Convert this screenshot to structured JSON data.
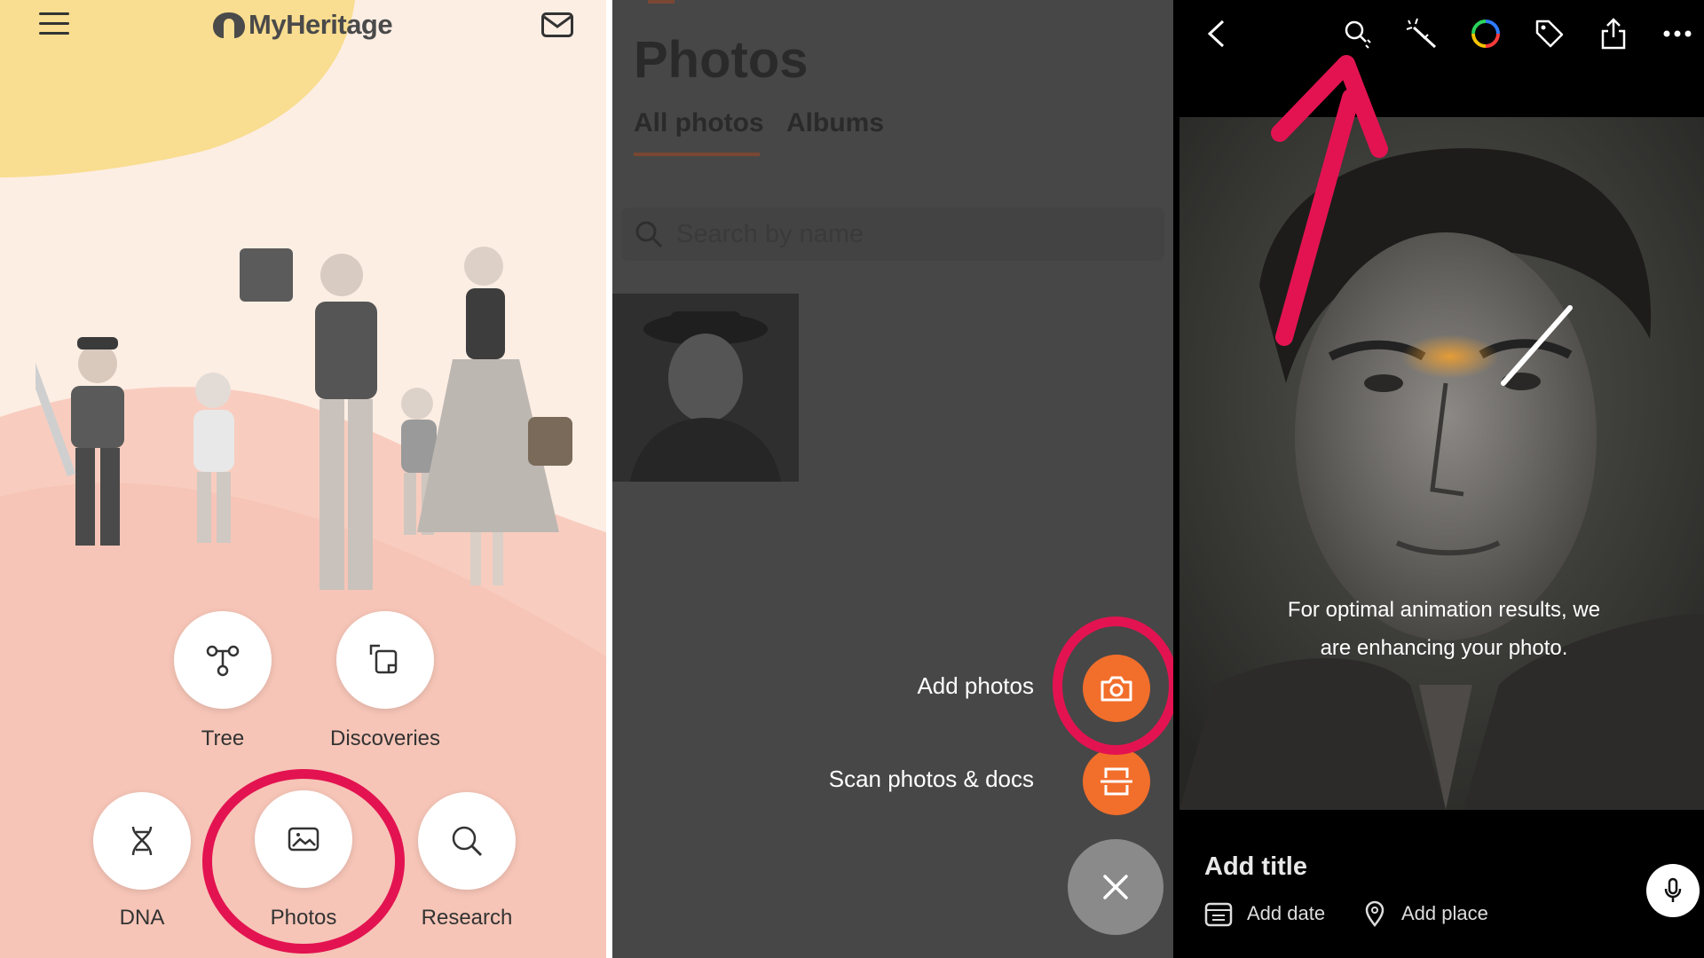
{
  "colors": {
    "accent_orange": "#f26e2b",
    "annotation_red": "#e31351",
    "dark_bg": "#474747"
  },
  "home": {
    "logo_text": "MyHeritage",
    "menu_icon": "hamburger-icon",
    "mail_icon": "mail-icon",
    "buttons": [
      {
        "id": "tree",
        "label": "Tree",
        "icon": "tree-icon"
      },
      {
        "id": "discoveries",
        "label": "Discoveries",
        "icon": "discoveries-icon"
      },
      {
        "id": "dna",
        "label": "DNA",
        "icon": "dna-icon"
      },
      {
        "id": "photos",
        "label": "Photos",
        "icon": "photos-icon"
      },
      {
        "id": "research",
        "label": "Research",
        "icon": "search-icon"
      }
    ]
  },
  "photos_screen": {
    "title": "Photos",
    "tabs": [
      {
        "label": "All photos",
        "active": true
      },
      {
        "label": "Albums",
        "active": false
      }
    ],
    "search_placeholder": "Search by name",
    "menu": [
      {
        "label": "Add photos",
        "icon": "camera-icon"
      },
      {
        "label": "Scan photos & docs",
        "icon": "scan-icon"
      }
    ],
    "close_icon": "close-icon"
  },
  "photo_viewer": {
    "toolbar": [
      "back-icon",
      "enhance-icon",
      "animate-icon",
      "colorize-icon",
      "tag-icon",
      "share-icon",
      "more-icon"
    ],
    "message": "For optimal animation results, we are enhancing your photo.",
    "add_title": "Add title",
    "add_date": "Add date",
    "add_place": "Add place",
    "mic_icon": "microphone-icon"
  }
}
